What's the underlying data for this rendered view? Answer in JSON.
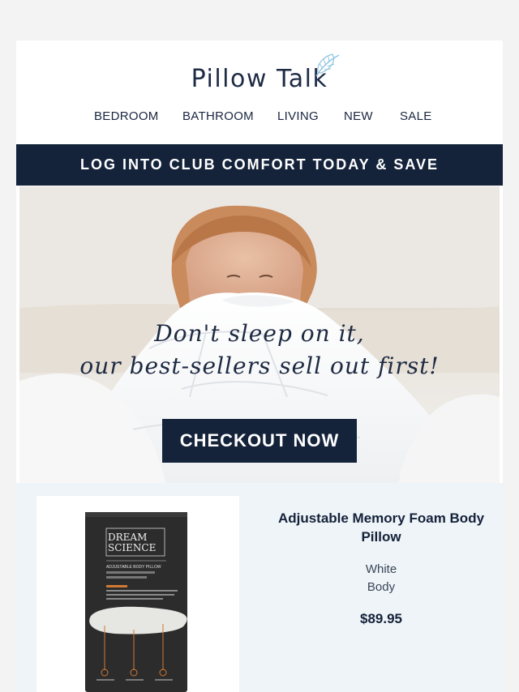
{
  "brand": {
    "name": "Pillow Talk",
    "logo_icon": "feather-icon",
    "accent": "#8ec3e2"
  },
  "nav": {
    "items": [
      {
        "label": "BEDROOM"
      },
      {
        "label": "BATHROOM"
      },
      {
        "label": "LIVING"
      },
      {
        "label": "NEW"
      },
      {
        "label": "SALE"
      }
    ]
  },
  "banner": {
    "label": "LOG INTO CLUB COMFORT TODAY & SAVE",
    "bg": "#14223a"
  },
  "hero": {
    "headline_line1": "Don't sleep on it,",
    "headline_line2": "our best-sellers sell out first!",
    "cta_label": "CHECKOUT NOW"
  },
  "product": {
    "title": "Adjustable Memory Foam Body Pillow",
    "color": "White",
    "size": "Body",
    "price": "$89.95",
    "box": {
      "brand_line1": "DREAM",
      "brand_line2": "SCIENCE",
      "product_line": "ADJUSTABLE BODY PILLOW"
    }
  }
}
